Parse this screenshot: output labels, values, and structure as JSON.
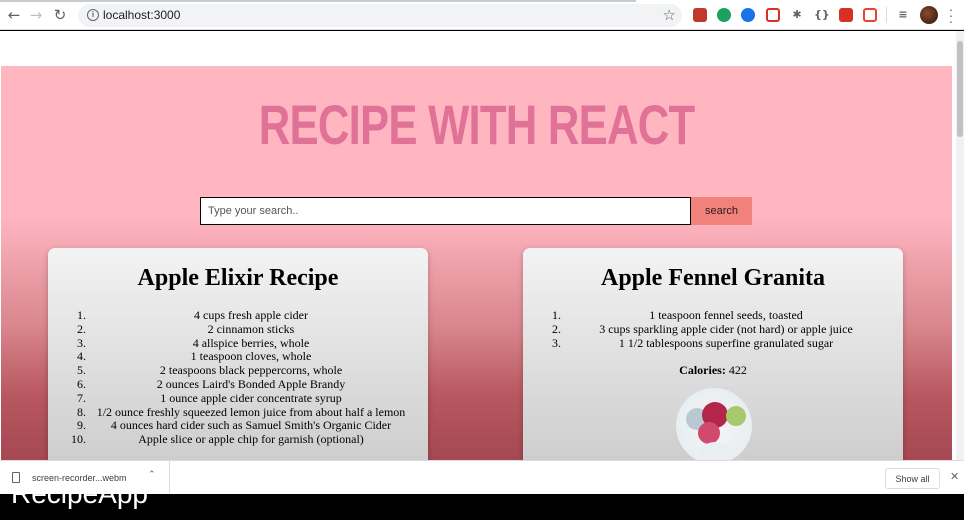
{
  "browser": {
    "url": "localhost:3000",
    "icons": [
      "back-icon",
      "forward-icon",
      "reload-icon",
      "site-info-icon",
      "bookmark-star-icon"
    ],
    "extension_colors": [
      "#c0392b",
      "#1aa260",
      "#1a73e8",
      "#d93025",
      "#5f6368",
      "#5f6368",
      "#d93025",
      "#ea4335"
    ]
  },
  "app": {
    "title": "RECIPE WITH REACT",
    "title_color": "#e07197",
    "background_color": "#ffb6c1",
    "search": {
      "placeholder": "Type your search..",
      "button_label": "search",
      "button_color": "#f0817b"
    },
    "recipes": [
      {
        "title": "Apple Elixir Recipe",
        "ingredients": [
          "4 cups fresh apple cider",
          "2 cinnamon sticks",
          "4 allspice berries, whole",
          "1 teaspoon cloves, whole",
          "2 teaspoons black peppercorns, whole",
          "2 ounces Laird's Bonded Apple Brandy",
          "1 ounce apple cider concentrate syrup",
          "1/2 ounce freshly squeezed lemon juice from about half a lemon",
          "4 ounces hard cider such as Samuel Smith's Organic Cider",
          "Apple slice or apple chip for garnish (optional)"
        ]
      },
      {
        "title": "Apple Fennel Granita",
        "ingredients": [
          "1 teaspoon fennel seeds, toasted",
          "3 cups sparkling apple cider (not hard) or apple juice",
          "1 1/2 tablespoons superfine granulated sugar"
        ],
        "calories_label": "Calories:",
        "calories_value": "422"
      }
    ]
  },
  "downloads": {
    "file_name": "screen-recorder...webm",
    "show_all_label": "Show all"
  },
  "overlay_caption": "RecipeApp"
}
